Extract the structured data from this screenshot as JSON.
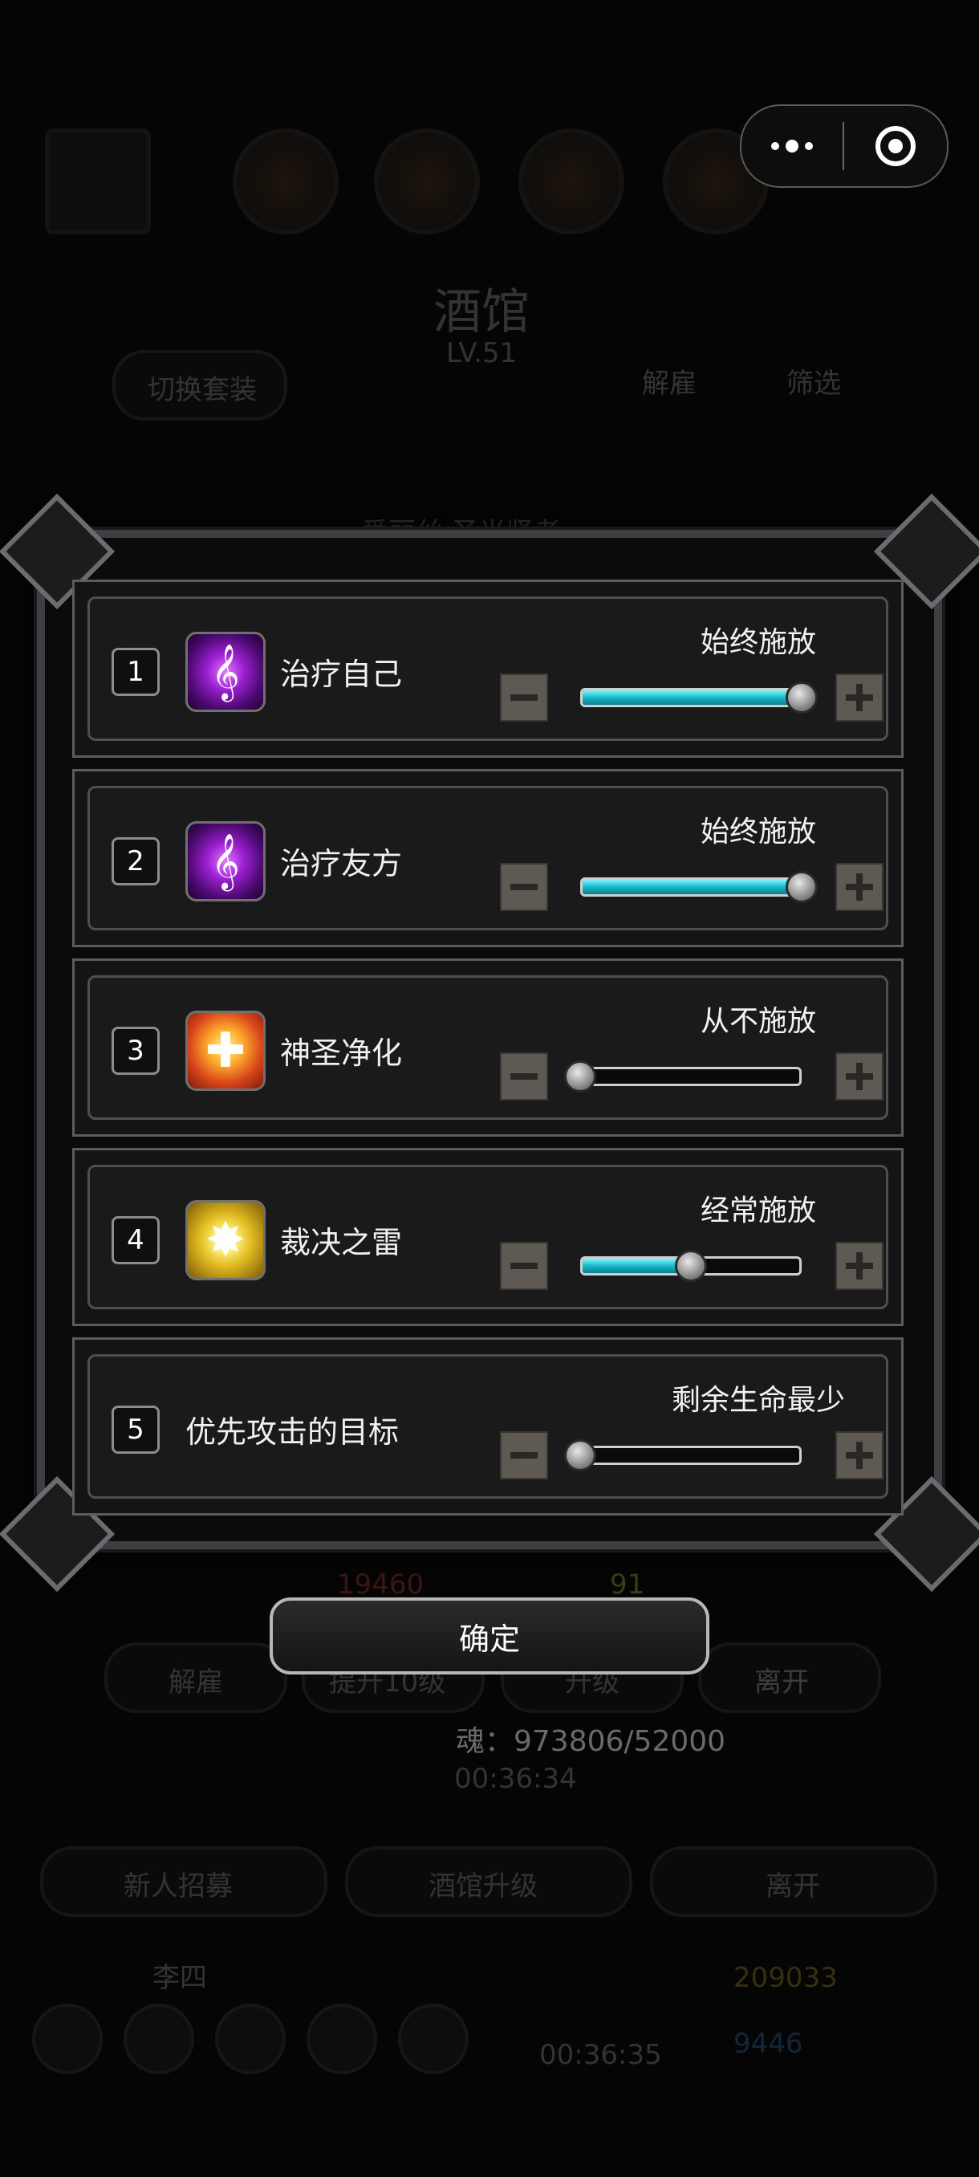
{
  "capsule": {
    "more_icon": "more-dots-icon",
    "close_icon": "target-close-icon"
  },
  "background": {
    "hero_title": "酒馆",
    "hero_level": "LV.51",
    "switch_set": "切换套装",
    "dismiss_tab": "解雇",
    "filter_tab": "筛选",
    "hero_name": "爱丽丝·圣光贤者",
    "hp_value": "19460",
    "energy_value": "91",
    "btn_dismiss": "解雇",
    "btn_upgrade": "提升10级",
    "btn_levelup": "升级",
    "btn_leave": "离开",
    "timer_1": "00:36:34",
    "recruit": "新人招募",
    "tavern_upgrade": "酒馆升级",
    "leave": "离开",
    "player_name": "李四",
    "gold": "209033",
    "gems": "9446",
    "timer_2": "00:36:35"
  },
  "skills": [
    {
      "number": "1",
      "name": "治疗自己",
      "icon": "heal-self-icon",
      "mode": "始终施放",
      "level": 1.0
    },
    {
      "number": "2",
      "name": "治疗友方",
      "icon": "heal-ally-icon",
      "mode": "始终施放",
      "level": 1.0
    },
    {
      "number": "3",
      "name": "神圣净化",
      "icon": "holy-purify-icon",
      "mode": "从不施放",
      "level": 0.0
    },
    {
      "number": "4",
      "name": "裁决之雷",
      "icon": "thunder-judgment-icon",
      "mode": "经常施放",
      "level": 0.5
    },
    {
      "number": "5",
      "name": "优先攻击的目标",
      "icon": "",
      "mode": "剩余生命最少",
      "level": 0.0
    }
  ],
  "confirm_label": "确定",
  "soul_text": "魂：973806/52000",
  "colors": {
    "slider_fill": "#19b8c8",
    "stepper": "#5f5953"
  }
}
